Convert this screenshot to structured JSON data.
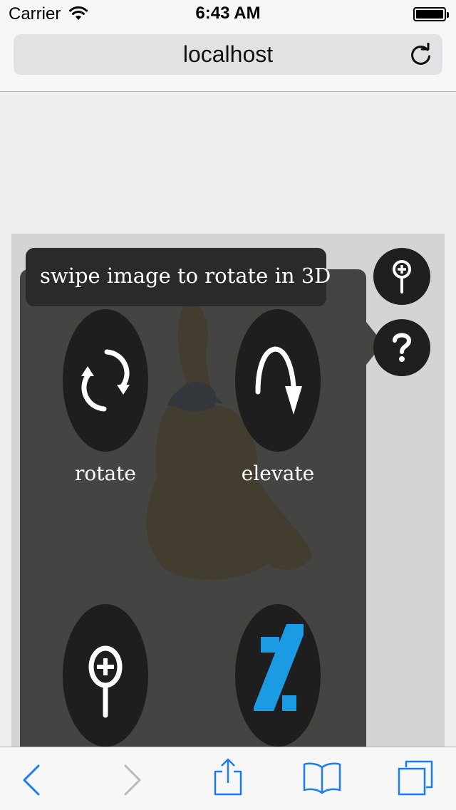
{
  "status_bar": {
    "carrier": "Carrier",
    "time": "6:43 AM"
  },
  "browser": {
    "url": "localhost"
  },
  "viewer": {
    "tooltip": "swipe image to rotate in 3D",
    "controls": {
      "rotate_label": "rotate",
      "elevate_label": "elevate"
    },
    "side_buttons": {
      "zoom_icon": "zoom-magnifier-plus-icon",
      "help_icon": "help-question-icon"
    }
  },
  "colors": {
    "ios_blue": "#1a7cf5",
    "zoomify_blue": "#1b9be3",
    "panel": "#343432"
  }
}
